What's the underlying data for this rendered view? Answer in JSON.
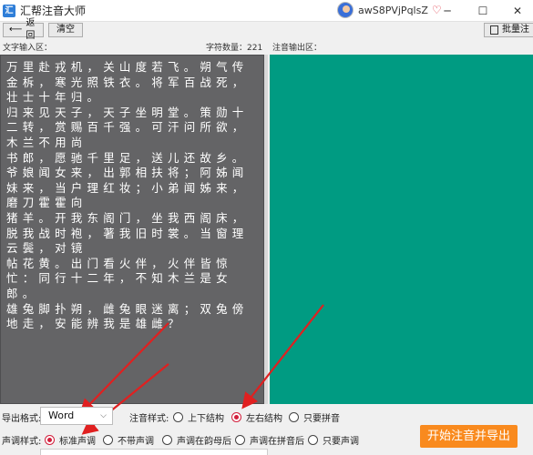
{
  "window": {
    "title": "汇帮注音大师",
    "app_icon_text": "汇",
    "username": "awS8PVjPqlsZ"
  },
  "toolbar": {
    "back_label": "返回",
    "clear_label": "清空",
    "batch_label": "批量注"
  },
  "input": {
    "header": "文字输入区：",
    "char_count_label": "字符数量：",
    "char_count": "221",
    "text": "万里赴戎机，关山度若飞。朔气传金柝，寒光照铁衣。将军百战死，壮士十年归。\n归来见天子，天子坐明堂。策勋十二转，赏赐百千强。可汗问所欲，木兰不用尚\n书郎，愿驰千里足，送儿还故乡。\n爷娘闻女来，出郭相扶将；阿姊闻妹来，当户理红妆；小弟闻姊来，磨刀霍霍向\n猪羊。开我东阁门，坐我西阁床，脱我战时袍，著我旧时裳。当窗理云鬓，对镜\n帖花黄。出门看火伴，火伴皆惊忙：同行十二年，不知木兰是女郎。\n雄兔脚扑朔，雌兔眼迷离；双兔傍地走，安能辨我是雄雌？"
  },
  "output": {
    "header": "注音输出区："
  },
  "options": {
    "export_format_label": "导出格式:",
    "export_format_value": "Word",
    "annotation_style_label": "注音样式:",
    "annotation_styles": [
      "上下结构",
      "左右结构",
      "只要拼音"
    ],
    "annotation_style_selected": "左右结构",
    "tone_style_label": "声调样式:",
    "tone_styles": [
      "标准声调",
      "不带声调",
      "声调在韵母后",
      "声调在拼音后",
      "只要声调"
    ],
    "tone_style_selected": "标准声调"
  },
  "start_button": "开始注音并导出",
  "colors": {
    "input_bg": "#646466",
    "output_bg": "#009b82",
    "start_button": "#f98a1e",
    "radio_checked": "#d21f3c",
    "annotation_arrow": "#e02020"
  }
}
